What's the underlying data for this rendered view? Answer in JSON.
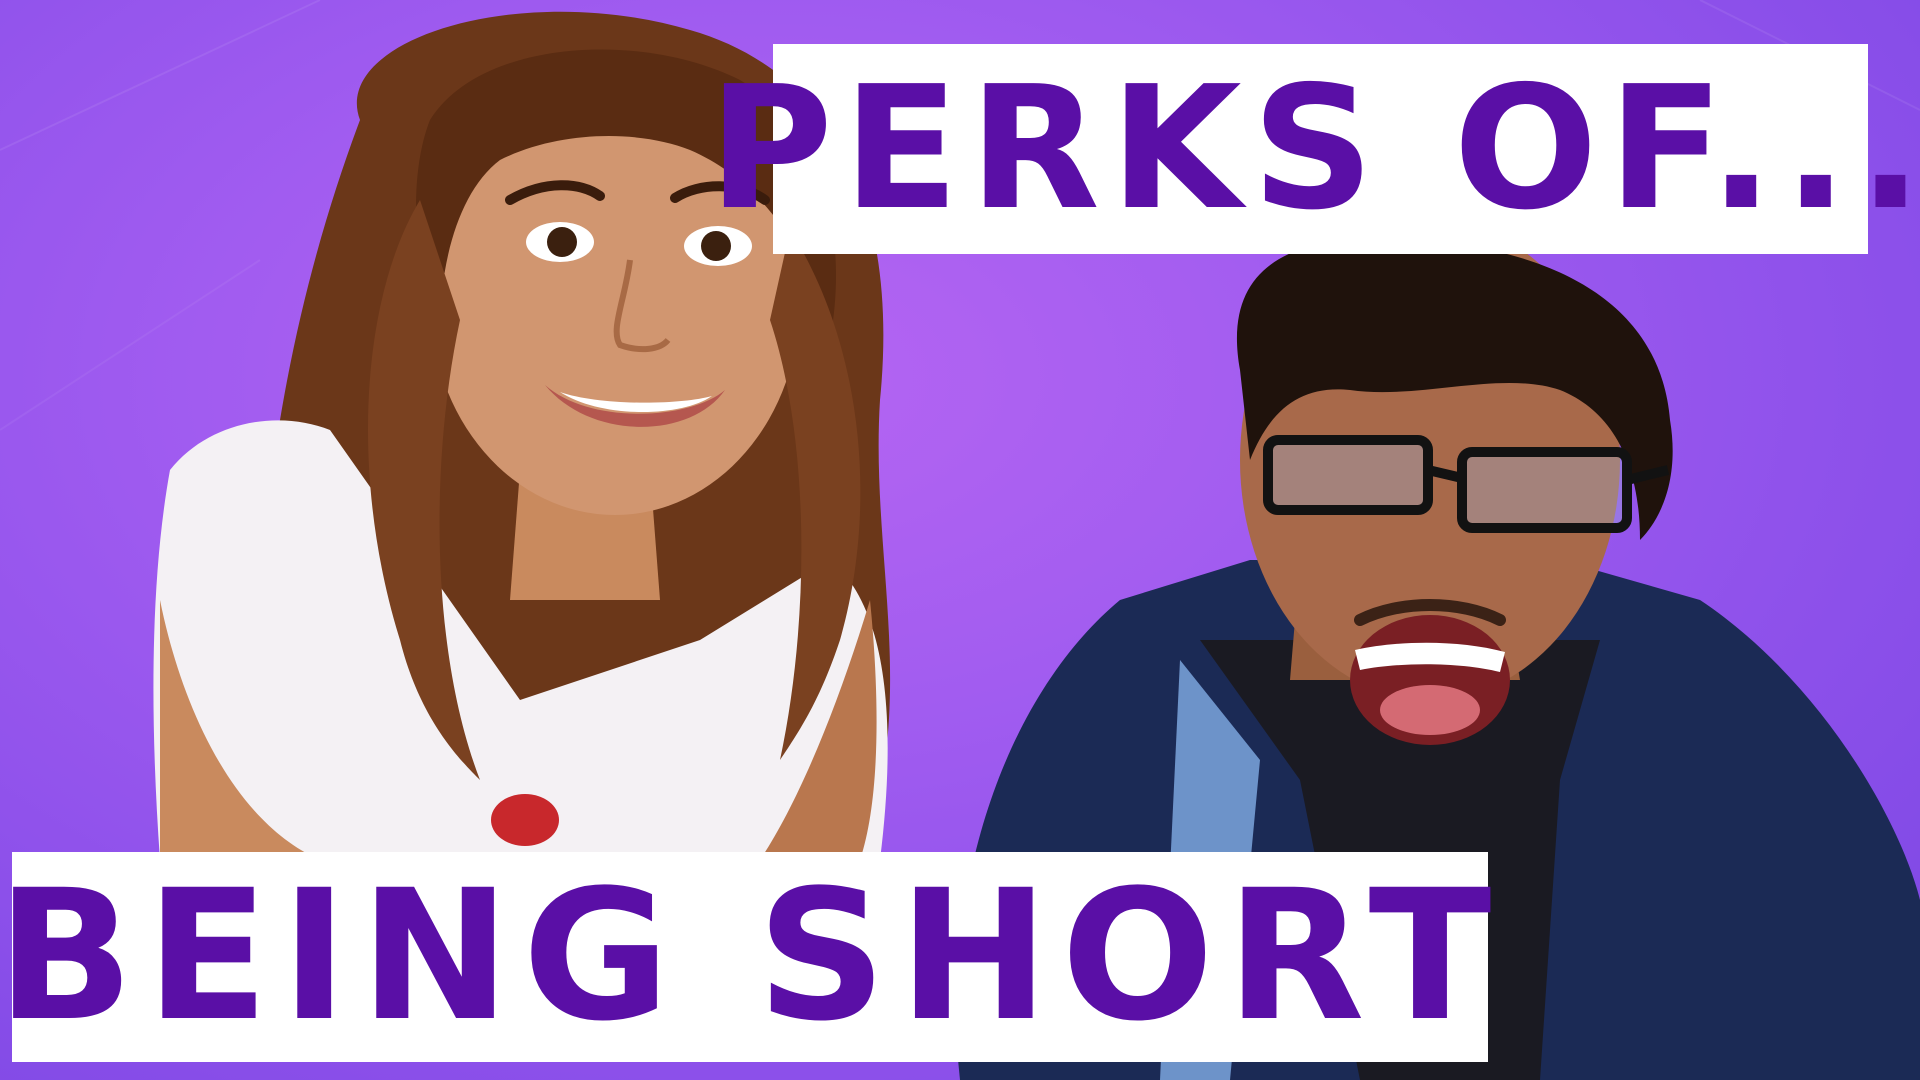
{
  "thumbnail": {
    "headline_top": "PERKS OF...",
    "headline_bottom": "BEING SHORT",
    "colors": {
      "background": "#a15cf0",
      "caption_text": "#5a0fa6",
      "caption_box": "#ffffff"
    }
  }
}
